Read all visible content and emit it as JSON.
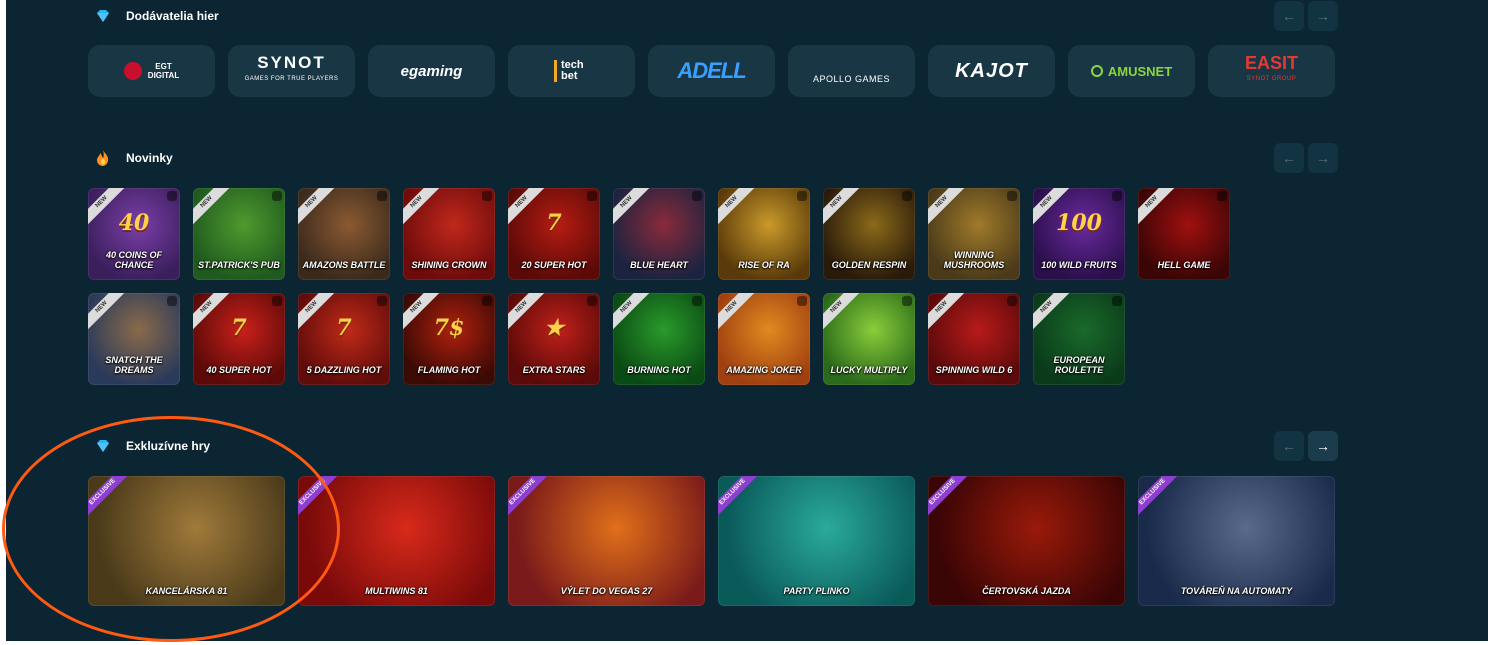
{
  "colors": {
    "background": "#0c2532",
    "card": "#183644",
    "arrow_bg": "#123341",
    "new_ribbon": "#dcdcdc",
    "exclusive_ribbon": "#8e3fd0",
    "annotation": "#ff5a12"
  },
  "sections": {
    "providers": {
      "title": "Dodávatelia hier",
      "icon": "diamond-icon",
      "prev": "←",
      "next": "→",
      "items": [
        {
          "name": "EGT",
          "sub": "DIGITAL",
          "bg": "#183644"
        },
        {
          "name": "SYNOT",
          "sub": "GAMES FOR TRUE PLAYERS",
          "bg": "#183644"
        },
        {
          "name": "egaming",
          "bg": "#183644"
        },
        {
          "name": "tech bet",
          "bg": "#183644"
        },
        {
          "name": "ADELL",
          "bg": "#183644"
        },
        {
          "name": "APOLLO GAMES",
          "bg": "#183644"
        },
        {
          "name": "KAJOT",
          "bg": "#183644"
        },
        {
          "name": "AMUSNET",
          "bg": "#183644"
        },
        {
          "name": "EASIT",
          "sub": "SYNOT GROUP",
          "bg": "#183644"
        }
      ]
    },
    "new": {
      "title": "Novinky",
      "icon": "fire-icon",
      "prev": "←",
      "next": "→",
      "ribbon": "NEW",
      "row1": [
        {
          "label": "40 COINS OF CHANCE",
          "art": "40",
          "c1": "#3a1f5c",
          "c2": "#7b3ea8"
        },
        {
          "label": "ST.PATRICK'S PUB",
          "art": "",
          "c1": "#1f5a1e",
          "c2": "#4f9a2e"
        },
        {
          "label": "AMAZONS BATTLE",
          "art": "",
          "c1": "#3b2a1c",
          "c2": "#8a5a32"
        },
        {
          "label": "SHINING CROWN",
          "art": "",
          "c1": "#6e0b0b",
          "c2": "#c0281c"
        },
        {
          "label": "20 SUPER HOT",
          "art": "7",
          "c1": "#5c0a08",
          "c2": "#b51c12"
        },
        {
          "label": "BLUE HEART",
          "art": "",
          "c1": "#1b2340",
          "c2": "#8a2a3a"
        },
        {
          "label": "RISE OF RA",
          "art": "",
          "c1": "#5a3a0a",
          "c2": "#c99a2a"
        },
        {
          "label": "GOLDEN RESPIN",
          "art": "",
          "c1": "#2a1a0a",
          "c2": "#8a6a1a"
        },
        {
          "label": "WINNING MUSHROOMS",
          "art": "",
          "c1": "#4a3a1a",
          "c2": "#a07a2a"
        },
        {
          "label": "100 WILD FRUITS",
          "art": "100",
          "c1": "#2a0f4a",
          "c2": "#6a2aa0"
        },
        {
          "label": "HELL GAME",
          "art": "",
          "c1": "#3a0505",
          "c2": "#a01010"
        }
      ],
      "row2": [
        {
          "label": "SNATCH THE DREAMS",
          "art": "",
          "c1": "#2a3a5a",
          "c2": "#8a6a4a"
        },
        {
          "label": "40 SUPER HOT",
          "art": "7",
          "c1": "#5c0a08",
          "c2": "#c8201a"
        },
        {
          "label": "5 DAZZLING HOT",
          "art": "7",
          "c1": "#600c0a",
          "c2": "#c02a18"
        },
        {
          "label": "FLAMING HOT",
          "art": "7$",
          "c1": "#3a0a04",
          "c2": "#b0200e"
        },
        {
          "label": "EXTRA STARS",
          "art": "★",
          "c1": "#5a0a08",
          "c2": "#c0201a"
        },
        {
          "label": "BURNING HOT",
          "art": "",
          "c1": "#0a4a14",
          "c2": "#2a9a2a"
        },
        {
          "label": "AMAZING JOKER",
          "art": "",
          "c1": "#a04010",
          "c2": "#e08a20"
        },
        {
          "label": "LUCKY MULTIPLY",
          "art": "",
          "c1": "#2a6a1a",
          "c2": "#8acd3a"
        },
        {
          "label": "SPINNING WILD 6",
          "art": "",
          "c1": "#5a0a0a",
          "c2": "#b81a1a"
        },
        {
          "label": "EUROPEAN ROULETTE",
          "art": "",
          "c1": "#0a3a1a",
          "c2": "#1a6a2a"
        }
      ]
    },
    "exclusive": {
      "title": "Exkluzívne hry",
      "icon": "diamond-icon",
      "prev": "←",
      "next": "→",
      "ribbon": "EXCLUSIVE",
      "items": [
        {
          "label": "KANCELÁRSKA 81",
          "c1": "#4a3a1a",
          "c2": "#a07a3a"
        },
        {
          "label": "MULTIWINS 81",
          "c1": "#7a0a0a",
          "c2": "#d82a1a"
        },
        {
          "label": "VÝLET DO VEGAS 27",
          "c1": "#7a1a1a",
          "c2": "#e0701a"
        },
        {
          "label": "PARTY PLINKO",
          "c1": "#0a5a5a",
          "c2": "#2aaa9a"
        },
        {
          "label": "ČERTOVSKÁ JAZDA",
          "c1": "#3a0505",
          "c2": "#9a1a0a"
        },
        {
          "label": "TOVÁREŇ NA AUTOMATY",
          "c1": "#1a2a4a",
          "c2": "#5a6a8a"
        }
      ]
    }
  }
}
